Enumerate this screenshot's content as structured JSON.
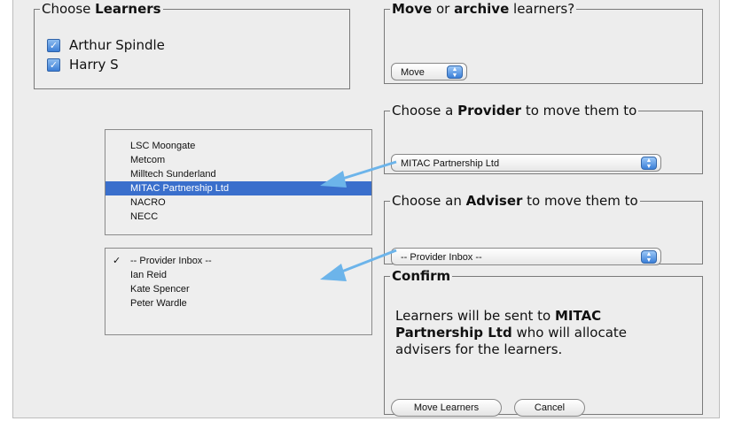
{
  "choose_learners": {
    "legend_prefix": "Choose ",
    "legend_bold": "Learners",
    "learners": [
      {
        "name": "Arthur Spindle",
        "checked": true
      },
      {
        "name": "Harry S",
        "checked": true
      }
    ]
  },
  "move_archive": {
    "legend_bold1": "Move",
    "legend_mid": " or ",
    "legend_bold2": "archive",
    "legend_suffix": " learners?",
    "selected": "Move"
  },
  "provider": {
    "legend_prefix": "Choose a ",
    "legend_bold": "Provider",
    "legend_suffix": " to move them to",
    "selected": "MITAC Partnership Ltd",
    "options": [
      "LSC Moongate",
      "Metcom",
      "Milltech Sunderland",
      "MITAC Partnership Ltd",
      "NACRO",
      "NECC"
    ],
    "highlighted_index": 3
  },
  "adviser": {
    "legend_prefix": "Choose an ",
    "legend_bold": "Adviser",
    "legend_suffix": " to move them to",
    "selected": "-- Provider Inbox --",
    "options": [
      "-- Provider Inbox --",
      "Ian Reid",
      "Kate Spencer",
      "Peter Wardle"
    ],
    "checked_index": 0,
    "check_mark": "✓"
  },
  "confirm": {
    "legend": "Confirm",
    "text_1": "Learners will be sent to ",
    "text_bold": "MITAC Partnership Ltd",
    "text_2": " who will allocate advisers for the learners.",
    "move_button": "Move Learners",
    "cancel_button": "Cancel"
  },
  "colors": {
    "selection": "#3a6fcc",
    "callout_arrow": "#6cb4ea",
    "background": "#ededed"
  }
}
